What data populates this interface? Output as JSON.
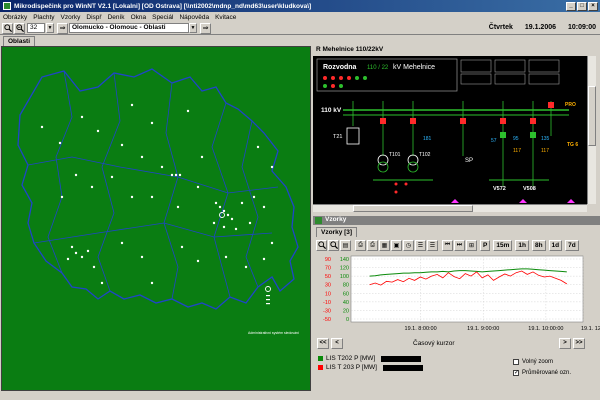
{
  "window": {
    "title": "Mikrodispečink pro WinNT V2.1  [Lokalni] [OD Ostrava] [\\\\nti2002\\mdnp_nd\\md63\\user\\kludkova\\]"
  },
  "menu": [
    "Obrázky",
    "Plachty",
    "Vzorky",
    "Dispř",
    "Deník",
    "Okna",
    "Speciál",
    "Nápověda",
    "Kvitace"
  ],
  "toolbar": {
    "zoom_value": "32",
    "region_value": "Olomucko - Olomouc - Oblasti"
  },
  "clock": {
    "day": "Čtvrtek",
    "date": "19.1.2006",
    "time": "10:09:00"
  },
  "left_panel": {
    "tab_label": "Oblasti",
    "map_note": "Administrativní systém sledování"
  },
  "scheme": {
    "title": "R Mehelnice 110/22kV",
    "header_label": "Rozvodna",
    "header_kv": "110 / 22",
    "header_station": "kV Mehelnice",
    "voltage_label": "110 kV",
    "transformer_label": "T21",
    "t101_label": "T101",
    "t102_label": "T102",
    "sp_label": "SP",
    "v572_label": "V572",
    "v508_label": "V508",
    "reading_1": "181",
    "reading_2": "57",
    "reading_3": "95",
    "reading_4": "135",
    "reading_5": "117",
    "reading_6": "117",
    "right_label": "PRO",
    "right_label2": "TG 6"
  },
  "graph": {
    "window_title": "Vzorky",
    "tab_label": "Vzorky [3]",
    "range_buttons": [
      "P",
      "15m",
      "1h",
      "8h",
      "1d",
      "7d"
    ],
    "time_axis_label": "Časový kurzor",
    "nav_buttons": [
      "<<",
      "<",
      ">",
      ">>"
    ],
    "legend": [
      {
        "label": "LIS T202  P [MW]",
        "color": "#0a8a0a"
      },
      {
        "label": "LIS T 203  P [MW]",
        "color": "#ff0000"
      }
    ],
    "options": [
      {
        "label": "Volný zoom",
        "checked": false
      },
      {
        "label": "Průměrované ozn.",
        "checked": true
      }
    ]
  },
  "chart_data": {
    "type": "line",
    "x_ticks": [
      "19.1. 8:00:00",
      "19.1. 9:00:00",
      "19.1. 10:00:00",
      "19.1. 12:00"
    ],
    "y_left_ticks": [
      90,
      70,
      50,
      30,
      10,
      -10,
      -30,
      -50
    ],
    "y_right_ticks": [
      140,
      120,
      100,
      80,
      60,
      40,
      20,
      0
    ],
    "left_axis_color": "#ff0000",
    "right_axis_color": "#0a8a0a",
    "ylim_right": [
      0,
      140
    ],
    "series": [
      {
        "name": "LIS T202  P [MW]",
        "color": "#0a8a0a",
        "values": [
          100,
          101,
          103,
          104,
          105,
          106,
          107,
          107,
          108,
          108,
          109,
          110,
          110,
          111,
          110,
          112,
          113,
          113,
          112,
          111,
          110,
          111,
          112,
          113,
          114,
          115,
          116,
          117,
          117,
          116,
          115,
          114,
          113,
          112,
          111,
          110
        ]
      },
      {
        "name": "LIS T 203  P [MW]",
        "color": "#ff0000",
        "values": [
          80,
          84,
          79,
          88,
          86,
          92,
          87,
          95,
          90,
          98,
          93,
          100,
          104,
          96,
          108,
          99,
          94,
          106,
          100,
          110,
          96,
          103,
          90,
          98,
          105,
          100,
          108,
          112,
          104,
          110,
          102,
          98,
          100,
          95,
          90,
          82
        ]
      }
    ]
  }
}
